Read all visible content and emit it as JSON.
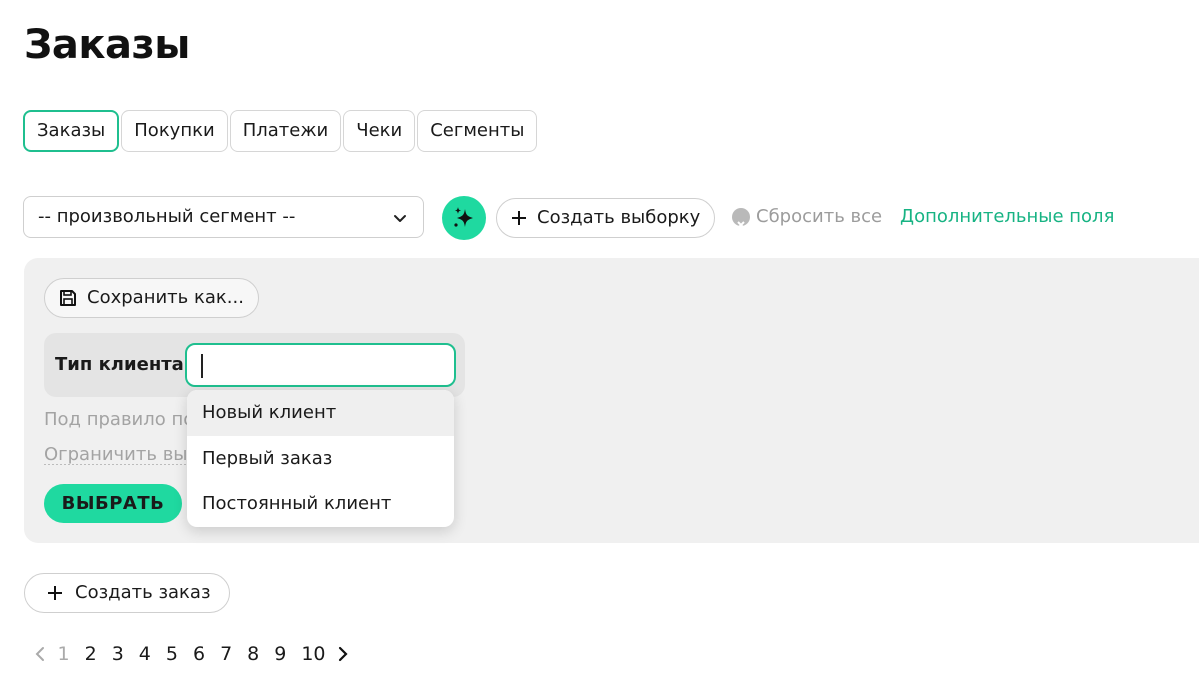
{
  "page": {
    "title": "Заказы"
  },
  "tabs": [
    {
      "label": "Заказы",
      "active": true
    },
    {
      "label": "Покупки"
    },
    {
      "label": "Платежи"
    },
    {
      "label": "Чеки"
    },
    {
      "label": "Сегменты"
    }
  ],
  "toolbar": {
    "segment_value": "-- произвольный сегмент --",
    "segment_icon": "chevron-down-icon",
    "magic_icon": "sparkles-icon",
    "create_sample_label": "Создать выборку",
    "reset_all_label": "Сбросить все",
    "extra_fields_label": "Дополнительные поля"
  },
  "filter": {
    "save_as_label": "Сохранить как...",
    "rule_label": "Тип клиента",
    "rule_value": "",
    "rule_hint": "Под правило подходит",
    "limit_link": "Ограничить выборку",
    "choose_label": "ВЫБРАТЬ",
    "dropdown_options": [
      "Новый клиент",
      "Первый заказ",
      "Постоянный клиент"
    ]
  },
  "actions": {
    "create_order_label": "Создать заказ"
  },
  "pagination": {
    "current": 1,
    "pages": [
      "1",
      "2",
      "3",
      "4",
      "5",
      "6",
      "7",
      "8",
      "9",
      "10"
    ]
  },
  "colors": {
    "accent": "#1fd9a0",
    "accent_border": "#1fbf8f",
    "link": "#17b383",
    "panel_bg": "#f0f0f0"
  }
}
